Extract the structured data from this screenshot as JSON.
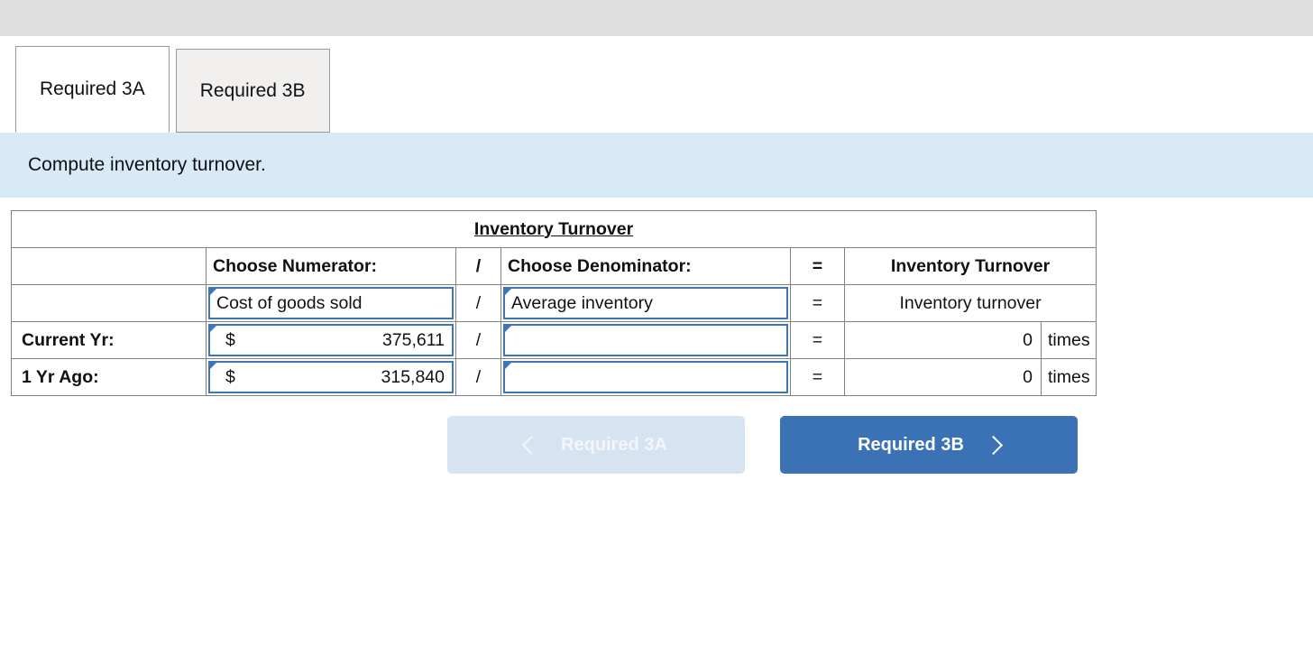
{
  "tabs": [
    {
      "label": "Required 3A",
      "active": true
    },
    {
      "label": "Required 3B",
      "active": false
    }
  ],
  "instruction": "Compute inventory turnover.",
  "worksheet": {
    "title": "Inventory Turnover",
    "headers": {
      "blank": "",
      "numerator": "Choose Numerator:",
      "divide": "/",
      "denominator": "Choose Denominator:",
      "equals": "=",
      "result": "Inventory Turnover"
    },
    "formula_row": {
      "label": "",
      "numerator": "Cost of goods sold",
      "divide": "/",
      "denominator": "Average inventory",
      "equals": "=",
      "result": "Inventory turnover"
    },
    "rows": [
      {
        "label": "Current Yr:",
        "currency": "$",
        "numerator": "375,611",
        "divide": "/",
        "denominator": "",
        "equals": "=",
        "result": "0",
        "units": "times"
      },
      {
        "label": "1 Yr Ago:",
        "currency": "$",
        "numerator": "315,840",
        "divide": "/",
        "denominator": "",
        "equals": "=",
        "result": "0",
        "units": "times"
      }
    ]
  },
  "navigation": {
    "prev_label": "Required 3A",
    "next_label": "Required 3B",
    "prev_icon": "chevron-left-icon",
    "next_icon": "chevron-right-icon"
  },
  "colors": {
    "header_blue": "#7cade4",
    "instruction_blue": "#d9eaf7",
    "dropdown_border": "#3b76b8",
    "next_button": "#3a72b5",
    "prev_button": "#d6e3f0",
    "top_bar": "#dedede"
  }
}
